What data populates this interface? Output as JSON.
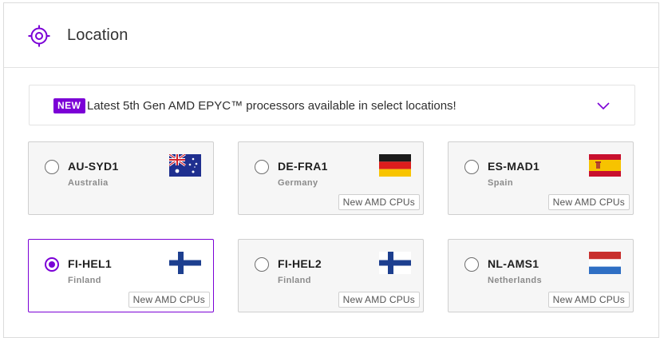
{
  "header": {
    "title": "Location",
    "icon": "location-target-icon",
    "accent": "#7b00d6"
  },
  "banner": {
    "badge": "NEW",
    "text": "Latest 5th Gen AMD EPYC™ processors available in select locations!",
    "chevron_icon": "chevron-down-icon"
  },
  "locations": [
    {
      "code": "AU-SYD1",
      "country": "Australia",
      "flag": "australia-flag-icon",
      "selected": false,
      "tag": ""
    },
    {
      "code": "DE-FRA1",
      "country": "Germany",
      "flag": "germany-flag-icon",
      "selected": false,
      "tag": "New AMD CPUs"
    },
    {
      "code": "ES-MAD1",
      "country": "Spain",
      "flag": "spain-flag-icon",
      "selected": false,
      "tag": "New AMD CPUs"
    },
    {
      "code": "FI-HEL1",
      "country": "Finland",
      "flag": "finland-flag-icon",
      "selected": true,
      "tag": "New AMD CPUs"
    },
    {
      "code": "FI-HEL2",
      "country": "Finland",
      "flag": "finland-flag-icon",
      "selected": false,
      "tag": "New AMD CPUs"
    },
    {
      "code": "NL-AMS1",
      "country": "Netherlands",
      "flag": "netherlands-flag-icon",
      "selected": false,
      "tag": "New AMD CPUs"
    }
  ]
}
